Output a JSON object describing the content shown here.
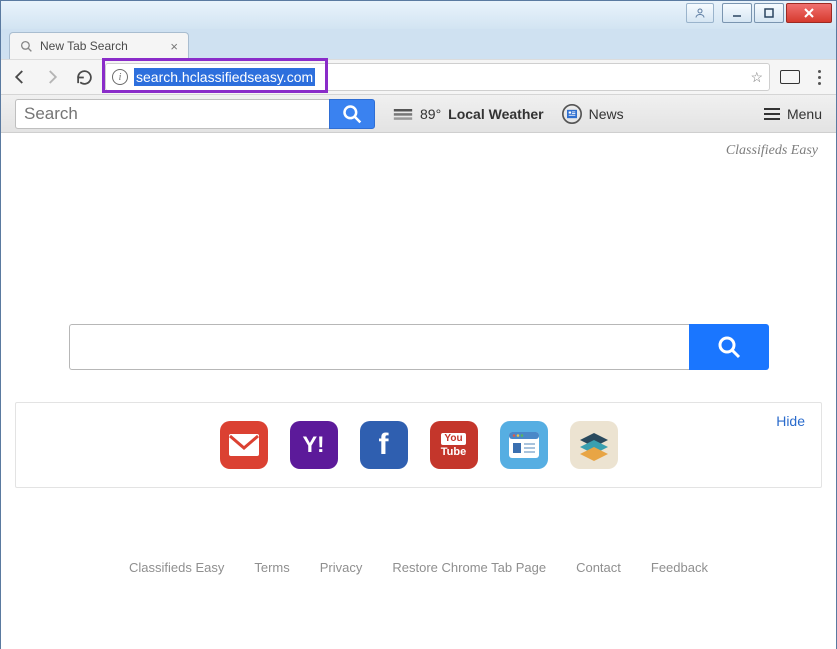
{
  "window": {
    "tab_title": "New Tab Search",
    "address": "search.hclassifiedseasy.com"
  },
  "topbar": {
    "search_placeholder": "Search",
    "weather_temp": "89°",
    "weather_label": "Local Weather",
    "news_label": "News",
    "menu_label": "Menu"
  },
  "brand": "Classifieds Easy",
  "panel": {
    "hide": "Hide",
    "tiles": {
      "gmail": "",
      "yahoo": "Y!",
      "facebook": "f",
      "youtube_top": "You",
      "youtube_bot": "Tube"
    }
  },
  "footer": {
    "a": "Classifieds Easy",
    "b": "Terms",
    "c": "Privacy",
    "d": "Restore Chrome Tab Page",
    "e": "Contact",
    "f": "Feedback"
  }
}
